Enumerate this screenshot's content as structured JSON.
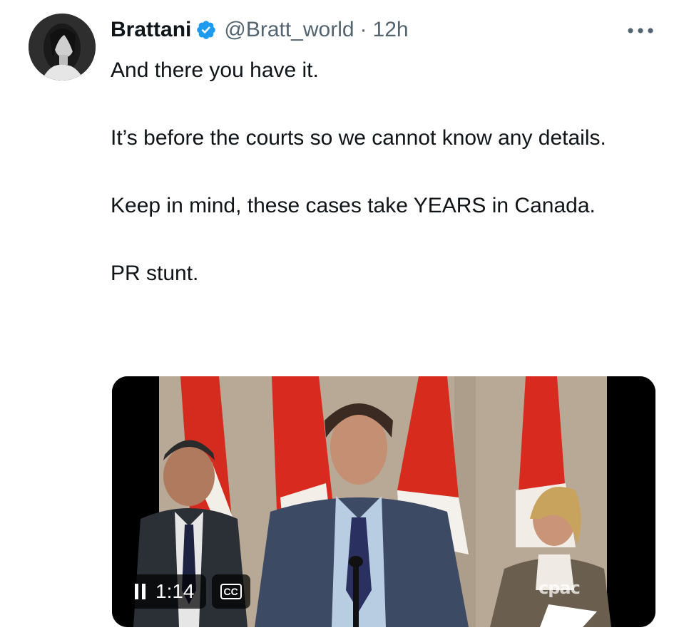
{
  "author": {
    "display_name": "Brattani",
    "handle": "@Bratt_world",
    "separator": "·",
    "timestamp": "12h",
    "verified": true,
    "verified_color": "#1d9bf0",
    "avatar_icon": "avatar-photo"
  },
  "more_icon": "more-horizontal-icon",
  "tweet": {
    "paragraphs": [
      "And there you have it.",
      "It’s before the courts so we cannot know any details.",
      "Keep in mind, these cases take YEARS in Canada.",
      "PR stunt."
    ]
  },
  "media": {
    "type": "video",
    "playback_time": "1:14",
    "pause_icon": "pause-icon",
    "cc_label": "CC",
    "watermark": "cpac"
  },
  "colors": {
    "text": "#0f1419",
    "secondary": "#536471",
    "verified": "#1d9bf0"
  }
}
